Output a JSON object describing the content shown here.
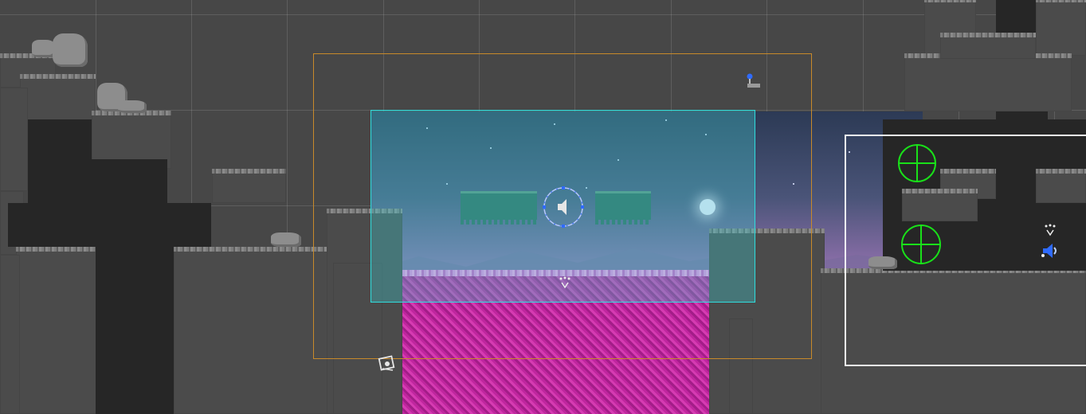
{
  "scene": {
    "background": "#474747",
    "gizmo_colors": {
      "camera_bounds": "#c88a2a",
      "trigger_zone": "#2fdede",
      "selection": "#f2f2f2",
      "target": "#19e019",
      "audio": "#2f6bff"
    }
  },
  "gizmos": [
    {
      "name": "audio-source-icon"
    },
    {
      "name": "camera-bounds-frame"
    },
    {
      "name": "trigger-zone"
    },
    {
      "name": "selection-box"
    },
    {
      "name": "crosshair-target-icon"
    },
    {
      "name": "crosshair-target-icon"
    },
    {
      "name": "light-icon"
    },
    {
      "name": "particle-emitter-icon"
    },
    {
      "name": "spawn-point-icon"
    }
  ]
}
